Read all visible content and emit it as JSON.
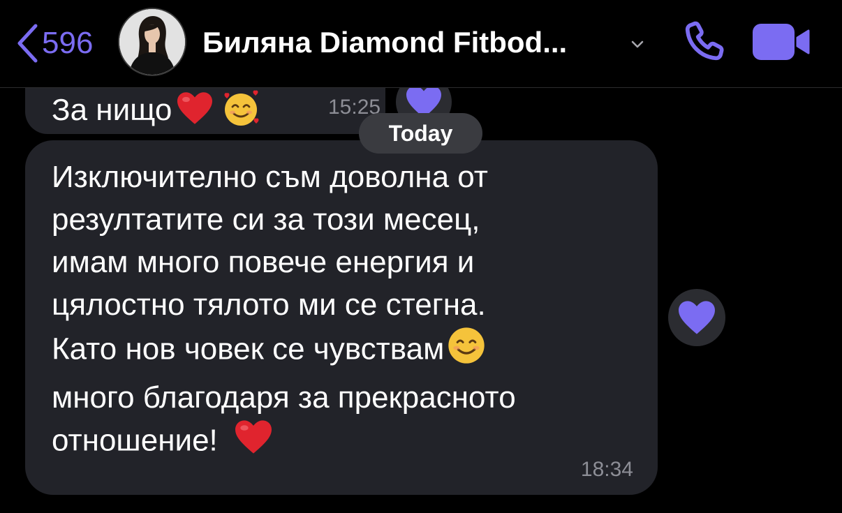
{
  "header": {
    "back_count": "596",
    "contact_name": "Биляна Diamond Fitbod..."
  },
  "messages": {
    "previous": {
      "text": "За нищо",
      "time": "15:25"
    },
    "date_separator": "Today",
    "main": {
      "lines": [
        "Изключително съм доволна от",
        "резултатите си за този месец,",
        "имам много повече енергия и",
        "цялостно тялото ми се стегна.",
        "Като нов човек се чувствам",
        "много благодаря за прекрасното",
        "отношение!"
      ],
      "time": "18:34"
    }
  },
  "icons": {
    "back": "chevron-left-icon",
    "dropdown": "chevron-down-icon",
    "call": "phone-icon",
    "video": "video-camera-icon",
    "reaction": "purple-heart-icon",
    "emoji_heart": "red-heart-emoji",
    "emoji_smiling_hearts": "smiling-face-with-hearts-emoji",
    "emoji_smile": "smiling-face-emoji"
  },
  "colors": {
    "accent": "#7b6cf2",
    "bubble": "#222329",
    "timestamp": "#8d8e96",
    "background": "#000000",
    "heart_red": "#e0242e"
  }
}
